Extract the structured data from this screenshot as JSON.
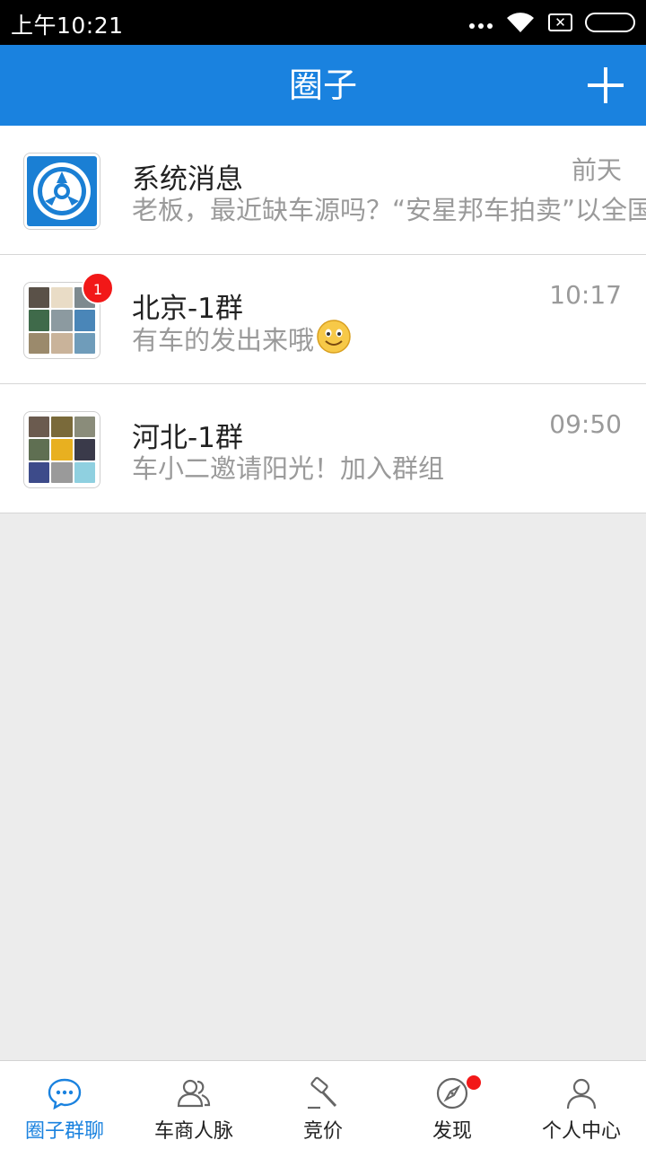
{
  "status_bar": {
    "time": "上午10:21",
    "sim_label": "✕",
    "icons": [
      "more-dots-icon",
      "wifi-icon",
      "no-sim-icon",
      "battery-icon"
    ]
  },
  "header": {
    "title": "圈子",
    "add_icon": "plus-icon"
  },
  "conversations": [
    {
      "name": "系统消息",
      "preview": "老板，最近缺车源吗？“安星邦车拍卖”以全国各地的二手车",
      "time": "前天",
      "avatar": "system-logo",
      "badge": ""
    },
    {
      "name": "北京-1群",
      "preview": "有车的发出来哦",
      "time": "10:17",
      "avatar": "group-photo-grid",
      "badge": "1",
      "emoji": "smiley-emoji"
    },
    {
      "name": "河北-1群",
      "preview": "车小二邀请阳光！加入群组",
      "time": "09:50",
      "avatar": "group-photo-grid",
      "badge": ""
    }
  ],
  "bottom_nav": [
    {
      "label": "圈子群聊",
      "icon": "chat-bubble-icon",
      "active": true
    },
    {
      "label": "车商人脉",
      "icon": "contacts-icon",
      "active": false
    },
    {
      "label": "竞价",
      "icon": "auction-hammer-icon",
      "active": false
    },
    {
      "label": "发现",
      "icon": "compass-icon",
      "active": false,
      "dot": true
    },
    {
      "label": "个人中心",
      "icon": "person-icon",
      "active": false
    }
  ],
  "colors": {
    "brand_blue": "#1a82df",
    "badge_red": "#f21818",
    "secondary_text": "#9a9a9a"
  }
}
